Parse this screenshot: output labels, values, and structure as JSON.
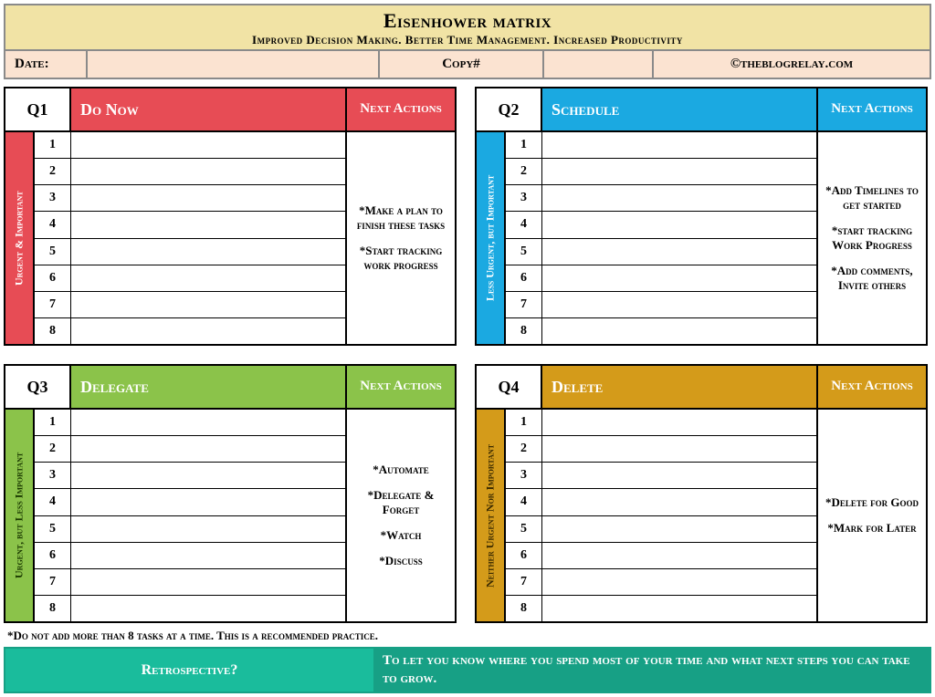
{
  "header": {
    "title": "Eisenhower matrix",
    "subtitle": "Improved Decision Making. Better Time Management. Increased Productivity",
    "date_label": "Date:",
    "date_value": "",
    "copy_label": "Copy#",
    "copy_value": "",
    "credit": "©theblogrelay.com"
  },
  "next_actions_label": "Next Actions",
  "quadrants": {
    "q1": {
      "code": "Q1",
      "title": "Do Now",
      "sidebar": "Urgent & Important",
      "actions": [
        "*Make a plan to finish these tasks",
        "*Start tracking work progress"
      ]
    },
    "q2": {
      "code": "Q2",
      "title": "Schedule",
      "sidebar": "Less Urgent, but Important",
      "actions": [
        "*Add Timelines to get started",
        "*start tracking Work Progress",
        "*Add comments, Invite others"
      ]
    },
    "q3": {
      "code": "Q3",
      "title": "Delegate",
      "sidebar": "Urgent, but Less Important",
      "actions": [
        "*Automate",
        "*Delegate & Forget",
        "*Watch",
        "*Discuss"
      ]
    },
    "q4": {
      "code": "Q4",
      "title": "Delete",
      "sidebar": "Neither Urgent Nor Important",
      "actions": [
        "*Delete for Good",
        "*Mark for Later"
      ]
    }
  },
  "row_numbers": [
    "1",
    "2",
    "3",
    "4",
    "5",
    "6",
    "7",
    "8"
  ],
  "footnote": "*Do not add more than 8 tasks at a time. This is a recommended practice.",
  "retro": {
    "label": "Retrospective?",
    "text": "To let you know where you spend most of your time and what next steps you can take to grow."
  }
}
